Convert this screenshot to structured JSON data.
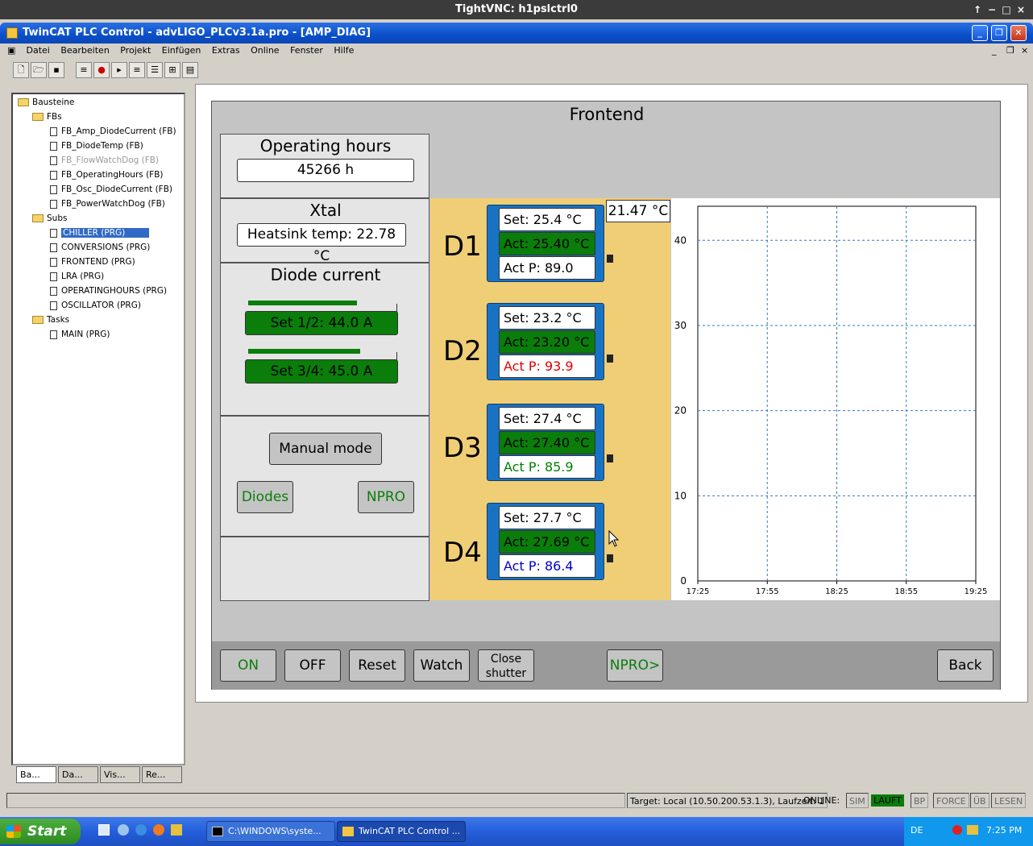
{
  "vnc": {
    "title": "TightVNC: h1pslctrl0",
    "up": "↑",
    "min": "−",
    "max": "□",
    "close": "×"
  },
  "app": {
    "title": "TwinCAT PLC Control - advLIGO_PLCv3.1a.pro - [AMP_DIAG]"
  },
  "menu": [
    "Datei",
    "Bearbeiten",
    "Projekt",
    "Einfügen",
    "Extras",
    "Online",
    "Fenster",
    "Hilfe"
  ],
  "tree": {
    "root": "Bausteine",
    "fbs_label": "FBs",
    "fbs": [
      "FB_Amp_DiodeCurrent (FB)",
      "FB_DiodeTemp (FB)",
      "FB_FlowWatchDog (FB)",
      "FB_OperatingHours (FB)",
      "FB_Osc_DiodeCurrent (FB)",
      "FB_PowerWatchDog (FB)"
    ],
    "subs_label": "Subs",
    "subs": [
      "CHILLER (PRG)",
      "CONVERSIONS (PRG)",
      "FRONTEND (PRG)",
      "LRA (PRG)",
      "OPERATINGHOURS (PRG)",
      "OSCILLATOR (PRG)"
    ],
    "tasks_label": "Tasks",
    "tasks": [
      "MAIN (PRG)"
    ],
    "selected": "CHILLER (PRG)"
  },
  "bottom_tabs": [
    "Ba...",
    "Da...",
    "Vis...",
    "Re..."
  ],
  "visu": {
    "title": "Frontend",
    "op_hours_label": "Operating hours",
    "op_hours_value": "45266 h",
    "xtal_label": "Xtal",
    "heatsink": "Heatsink temp: 22.78 °C",
    "diode_current_label": "Diode current",
    "set12": "Set 1/2: 44.0 A",
    "set34": "Set 3/4: 45.0 A",
    "bar12": 0.75,
    "bar34": 0.77,
    "manual_mode": "Manual mode",
    "diodes_btn": "Diodes",
    "npro_btn": "NPRO",
    "temp_readout": "21.47 °C",
    "diodes": [
      {
        "name": "D1",
        "set": "Set: 25.4 °C",
        "act": "Act: 25.40 °C",
        "actp": "Act P: 89.0",
        "pcolor": "#000000"
      },
      {
        "name": "D2",
        "set": "Set: 23.2 °C",
        "act": "Act: 23.20 °C",
        "actp": "Act P: 93.9",
        "pcolor": "#e00000"
      },
      {
        "name": "D3",
        "set": "Set: 27.4 °C",
        "act": "Act: 27.40 °C",
        "actp": "Act P: 85.9",
        "pcolor": "#008000"
      },
      {
        "name": "D4",
        "set": "Set: 27.7 °C",
        "act": "Act: 27.69 °C",
        "actp": "Act P: 86.4",
        "pcolor": "#0000d0"
      }
    ],
    "buttons": {
      "on": "ON",
      "off": "OFF",
      "reset": "Reset",
      "watch": "Watch",
      "close1": "Close",
      "close2": "shutter",
      "npro": "NPRO>",
      "back": "Back"
    }
  },
  "chart_data": {
    "type": "line",
    "x_ticks": [
      "17:25",
      "17:55",
      "18:25",
      "18:55",
      "19:25"
    ],
    "y_ticks": [
      0,
      10,
      20,
      30,
      40
    ],
    "ylim": [
      0,
      44
    ],
    "grid": true,
    "series": []
  },
  "status": {
    "target": "Target: Local (10.50.200.53.1.3), Laufzeit: 1",
    "online": "ONLINE:",
    "sim": "SIM",
    "lauft": "LAUFT",
    "bp": "BP",
    "force": "FORCE",
    "ub": "ÜB",
    "lesen": "LESEN"
  },
  "taskbar": {
    "start": "Start",
    "task1": "C:\\WINDOWS\\syste...",
    "task2": "TwinCAT PLC Control ...",
    "lang": "DE",
    "time": "7:25 PM"
  }
}
